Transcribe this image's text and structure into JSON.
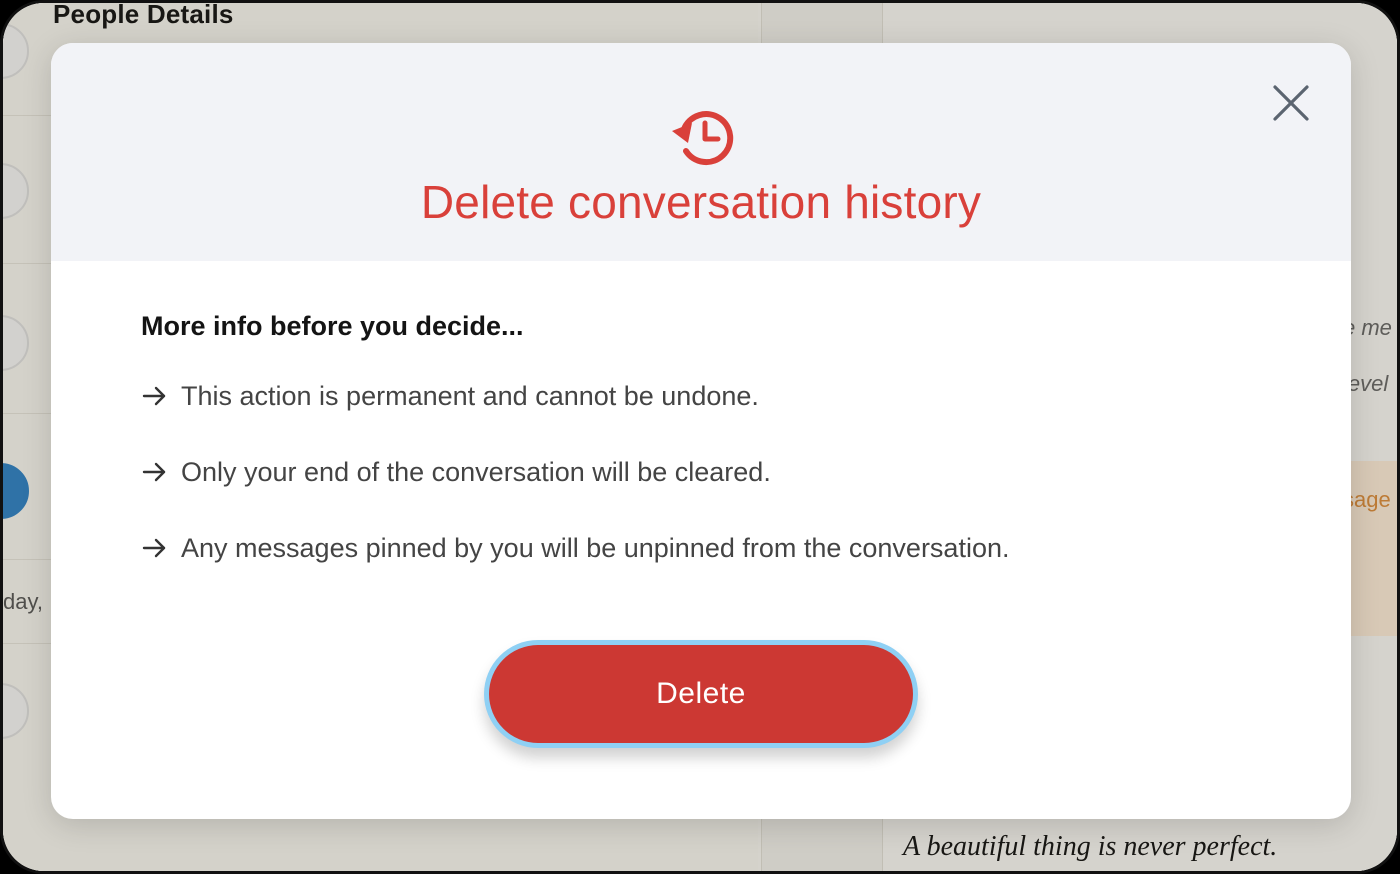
{
  "background": {
    "page_title": "People Details",
    "day_fragment": "day,",
    "right_fragments": [
      "e me",
      "level",
      "sage"
    ],
    "quote": "A beautiful thing is never perfect."
  },
  "modal": {
    "icon": "history-reverse-clock-icon",
    "title": "Delete conversation history",
    "close_icon": "close-icon",
    "subheading": "More info before you decide...",
    "items": [
      "This action is permanent and cannot be undone.",
      "Only your end of the conversation will be cleared.",
      "Any messages pinned by you will be unpinned from the conversation."
    ],
    "delete_label": "Delete",
    "colors": {
      "accent": "#d9403a",
      "button": "#cc3833",
      "focus_ring": "#8fd0f4",
      "header_bg": "#f2f3f7"
    }
  }
}
